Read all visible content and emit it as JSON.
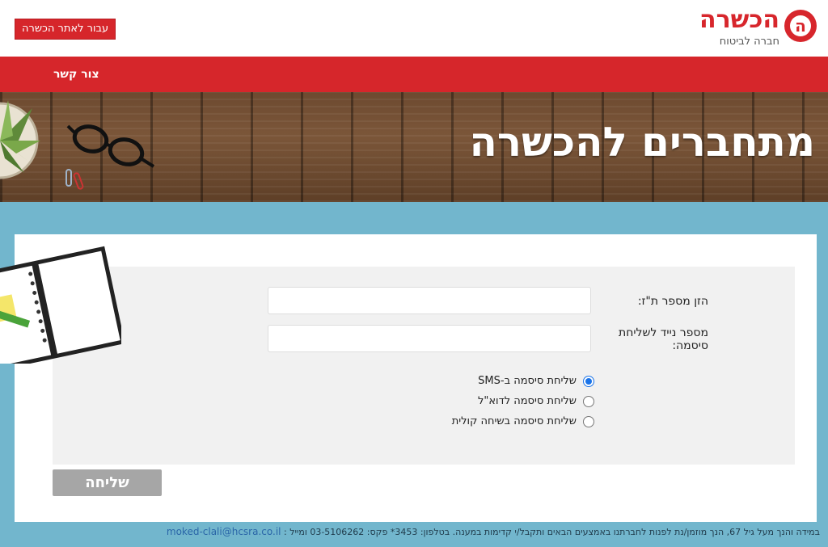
{
  "header": {
    "logo_text": "הכשרה",
    "logo_tagline": "חברה לביטוח",
    "site_button": "עבור לאתר הכשרה"
  },
  "nav": {
    "contact": "צור קשר"
  },
  "banner": {
    "title": "מתחברים להכשרה"
  },
  "form": {
    "id_label": "הזן מספר ת\"ז:",
    "id_value": "",
    "mobile_label": "מספר נייד לשליחת סיסמה:",
    "mobile_value": "",
    "options": [
      {
        "label": "שליחת סיסמה ב-SMS",
        "checked": true
      },
      {
        "label": "שליחת סיסמה לדוא\"ל",
        "checked": false
      },
      {
        "label": "שליחת סיסמה בשיחה קולית",
        "checked": false
      }
    ],
    "submit_label": "שליחה"
  },
  "footer": {
    "text": "במידה והנך מעל גיל 67, הנך מוזמן/נת לפנות לחברתנו באמצעים הבאים ותקבל/י קדימות במענה. בטלפון: 3453* פקס: 03-5106262 ומייל :",
    "email": "moked-clali@hcsra.co.il"
  },
  "colors": {
    "brand_red": "#d6262b",
    "page_blue": "#72b6cd",
    "radio_blue": "#1a73e8"
  }
}
